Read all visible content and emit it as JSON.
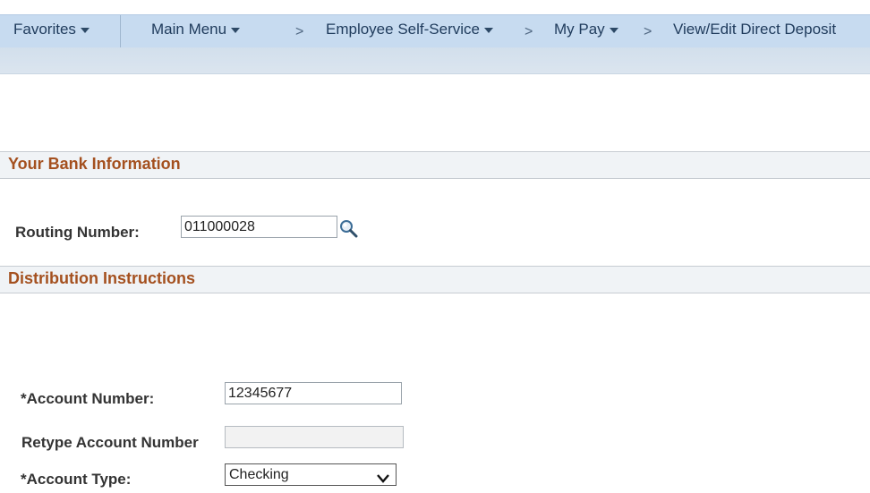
{
  "nav": {
    "favorites": "Favorites",
    "main_menu": "Main Menu",
    "employee_self_service": "Employee Self-Service",
    "my_pay": "My Pay",
    "current_page": "View/Edit Direct Deposit",
    "separator": ">"
  },
  "bank_section": {
    "title": "Your Bank Information",
    "routing_label": "Routing Number:",
    "routing_value": "011000028",
    "lookup_icon": "search-icon"
  },
  "distribution_section": {
    "title": "Distribution Instructions",
    "account_number_label": "*Account Number:",
    "account_number_value": "12345677",
    "retype_label": "Retype Account Number",
    "retype_value": "",
    "account_type_label": "*Account Type:",
    "account_type_value": "Checking"
  },
  "colors": {
    "section_title": "#a4501f",
    "nav_background": "#c7dbf0"
  }
}
